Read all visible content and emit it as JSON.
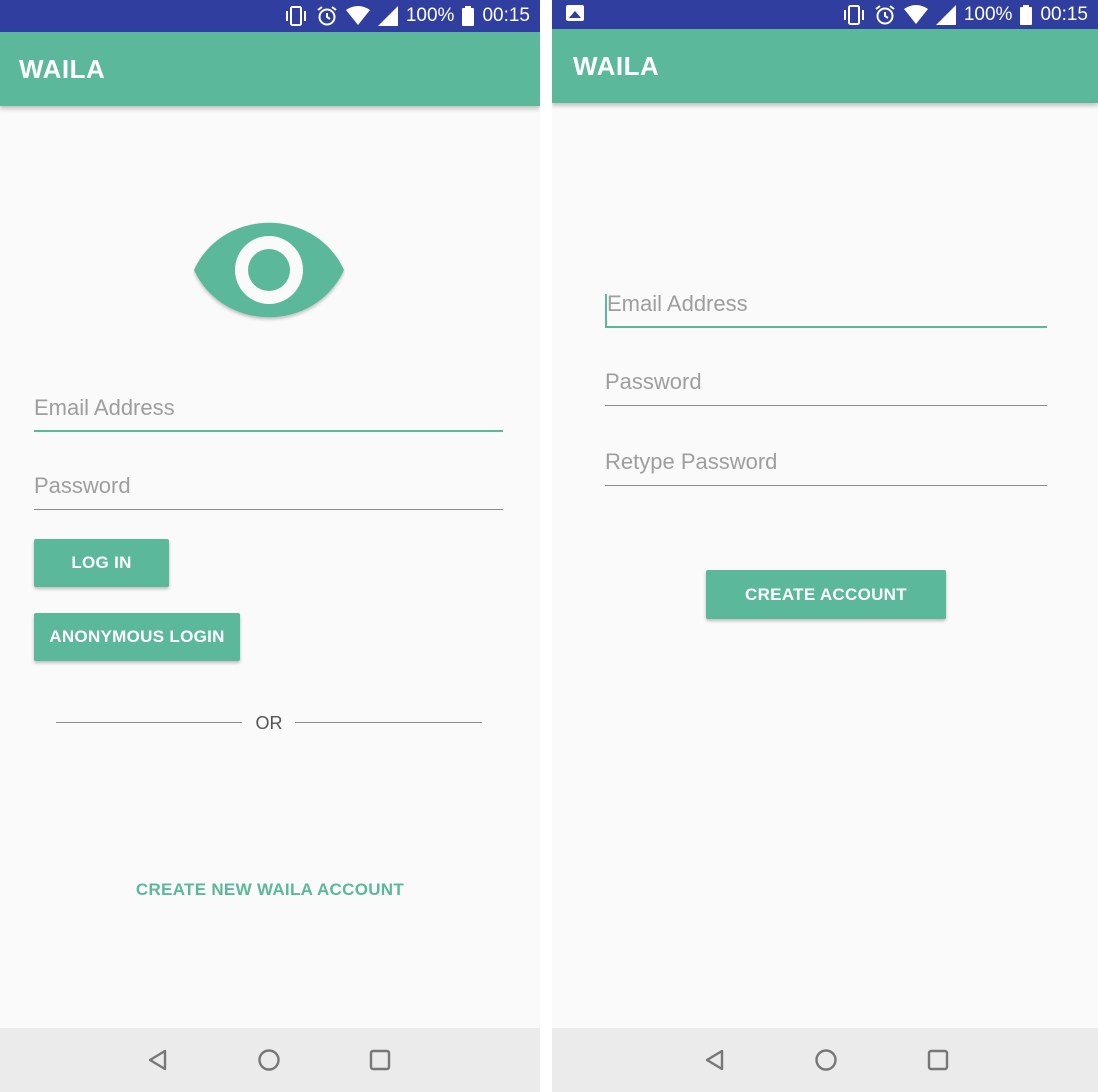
{
  "status_bar": {
    "battery": "100%",
    "time": "00:15"
  },
  "login_screen": {
    "app_title": "WAILA",
    "email_placeholder": "Email Address",
    "password_placeholder": "Password",
    "login_label": "LOG IN",
    "anonymous_login_label": "ANONYMOUS LOGIN",
    "divider_label": "OR",
    "create_account_link": "CREATE NEW WAILA ACCOUNT"
  },
  "register_screen": {
    "app_title": "WAILA",
    "email_placeholder": "Email Address",
    "password_placeholder": "Password",
    "retype_password_placeholder": "Retype Password",
    "create_account_label": "CREATE ACCOUNT"
  },
  "colors": {
    "status_bar": "#303f9f",
    "primary": "#5bb89a",
    "background": "#fafafa",
    "nav_bar": "#ebebeb"
  },
  "icons": {
    "status": [
      "vibrate-icon",
      "alarm-icon",
      "wifi-icon",
      "signal-icon",
      "battery-icon"
    ],
    "logo": "eye-icon",
    "nav": [
      "back-icon",
      "home-icon",
      "recents-icon"
    ]
  }
}
